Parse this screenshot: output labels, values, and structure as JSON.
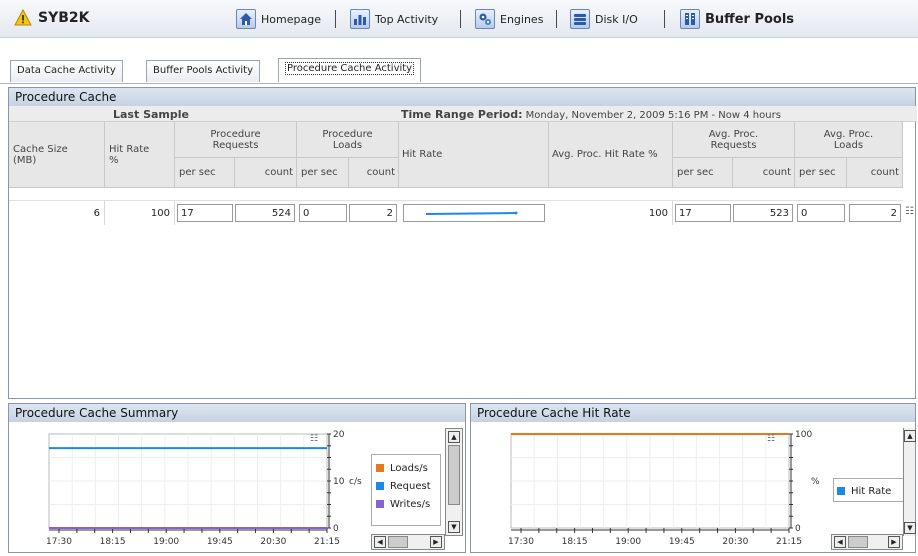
{
  "app": {
    "server_name": "SYB2K",
    "nav": [
      {
        "label": "Homepage"
      },
      {
        "label": "Top Activity"
      },
      {
        "label": "Engines"
      },
      {
        "label": "Disk I/O"
      },
      {
        "label": "Buffer Pools"
      }
    ],
    "tabs": [
      {
        "label": "Data Cache Activity"
      },
      {
        "label": "Buffer Pools Activity"
      },
      {
        "label": "Procedure Cache Activity"
      }
    ]
  },
  "procedure_cache": {
    "title": "Procedure Cache",
    "last_sample_label": "Last Sample",
    "time_range_label": "Time Range Period:",
    "time_range_value": "Monday, November 2, 2009  5:16 PM - Now  4 hours",
    "headers": {
      "cache_size": "Cache Size (MB)",
      "hit_rate_pct": "Hit Rate %",
      "proc_requests": "Procedure Requests",
      "proc_loads": "Procedure Loads",
      "hit_rate": "Hit Rate",
      "avg_hit_rate": "Avg. Proc. Hit Rate %",
      "avg_requests": "Avg. Proc. Requests",
      "avg_loads": "Avg. Proc. Loads",
      "per_sec": "per sec",
      "count": "count"
    },
    "row": {
      "cache_size": "6",
      "hit_rate": "100",
      "requests_per_sec": "17",
      "requests_count": "524",
      "loads_per_sec": "0",
      "loads_count": "2",
      "avg_hit_rate": "100",
      "avg_requests_per_sec": "17",
      "avg_requests_count": "523",
      "avg_loads_per_sec": "0",
      "avg_loads_count": "2"
    }
  },
  "summary_panel": {
    "title": "Procedure Cache Summary",
    "y_unit": "c/s",
    "legend": [
      {
        "label": "Loads/s",
        "color": "#e8781e"
      },
      {
        "label": "Request",
        "color": "#1e88e8"
      },
      {
        "label": "Writes/s",
        "color": "#8a5fd0"
      }
    ]
  },
  "hitrate_panel": {
    "title": "Procedure Cache Hit Rate",
    "y_unit": "%",
    "legend": [
      {
        "label": "Hit Rate",
        "color": "#1e88e8"
      }
    ]
  },
  "chart_data": [
    {
      "type": "line",
      "x": [
        "17:30",
        "18:15",
        "19:00",
        "19:45",
        "20:30",
        "21:15"
      ],
      "ylim": [
        0,
        20
      ],
      "yticks": [
        "20",
        "10",
        "0"
      ],
      "series": [
        {
          "name": "Request",
          "color": "#1e88e8",
          "values": [
            17,
            17,
            17,
            17,
            17,
            17
          ]
        },
        {
          "name": "Loads/s",
          "color": "#e8781e",
          "values": [
            0,
            0,
            0,
            0,
            0,
            0
          ]
        },
        {
          "name": "Writes/s",
          "color": "#8a5fd0",
          "values": [
            0,
            0,
            0,
            0,
            0,
            0
          ]
        }
      ]
    },
    {
      "type": "line",
      "x": [
        "17:30",
        "18:15",
        "19:00",
        "19:45",
        "20:30",
        "21:15"
      ],
      "ylim": [
        0,
        100
      ],
      "yticks": [
        "100",
        "0"
      ],
      "series": [
        {
          "name": "Hit Rate",
          "color": "#e8781e",
          "values": [
            100,
            100,
            100,
            100,
            100,
            100
          ]
        }
      ]
    }
  ]
}
